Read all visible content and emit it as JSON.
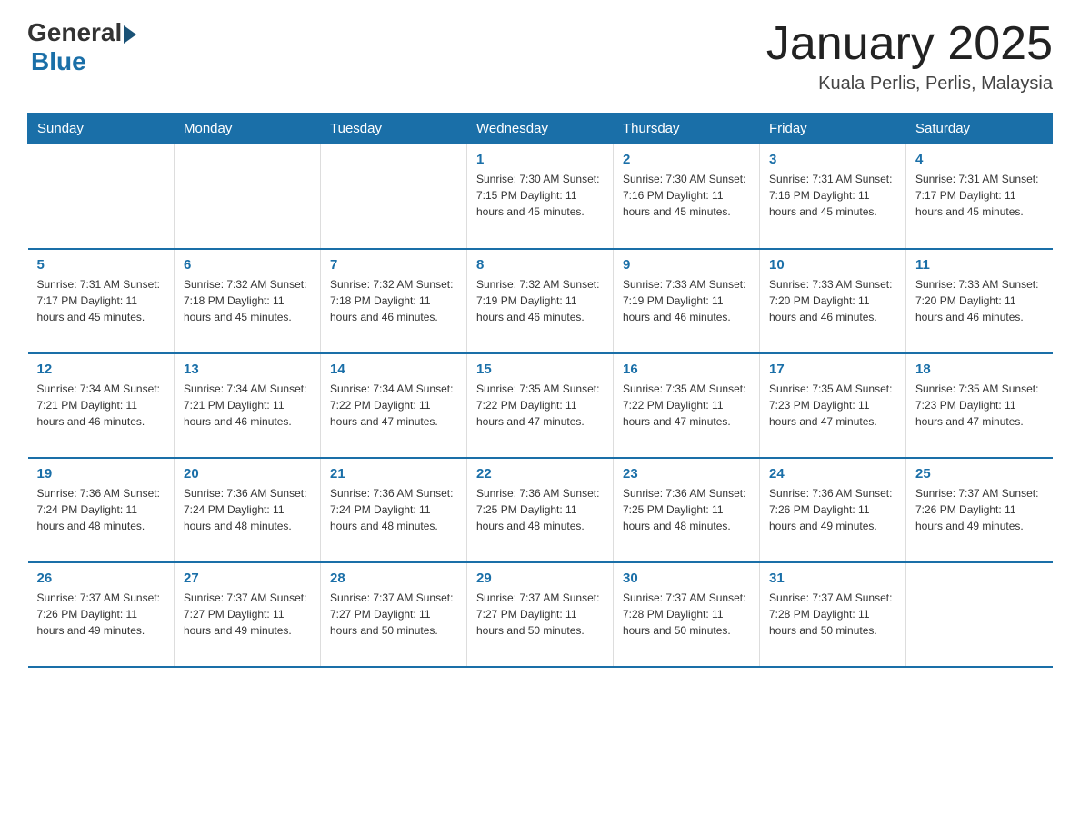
{
  "header": {
    "logo": {
      "general": "General",
      "blue": "Blue"
    },
    "title": "January 2025",
    "location": "Kuala Perlis, Perlis, Malaysia"
  },
  "days_of_week": [
    "Sunday",
    "Monday",
    "Tuesday",
    "Wednesday",
    "Thursday",
    "Friday",
    "Saturday"
  ],
  "weeks": [
    [
      {
        "day": "",
        "info": ""
      },
      {
        "day": "",
        "info": ""
      },
      {
        "day": "",
        "info": ""
      },
      {
        "day": "1",
        "info": "Sunrise: 7:30 AM\nSunset: 7:15 PM\nDaylight: 11 hours\nand 45 minutes."
      },
      {
        "day": "2",
        "info": "Sunrise: 7:30 AM\nSunset: 7:16 PM\nDaylight: 11 hours\nand 45 minutes."
      },
      {
        "day": "3",
        "info": "Sunrise: 7:31 AM\nSunset: 7:16 PM\nDaylight: 11 hours\nand 45 minutes."
      },
      {
        "day": "4",
        "info": "Sunrise: 7:31 AM\nSunset: 7:17 PM\nDaylight: 11 hours\nand 45 minutes."
      }
    ],
    [
      {
        "day": "5",
        "info": "Sunrise: 7:31 AM\nSunset: 7:17 PM\nDaylight: 11 hours\nand 45 minutes."
      },
      {
        "day": "6",
        "info": "Sunrise: 7:32 AM\nSunset: 7:18 PM\nDaylight: 11 hours\nand 45 minutes."
      },
      {
        "day": "7",
        "info": "Sunrise: 7:32 AM\nSunset: 7:18 PM\nDaylight: 11 hours\nand 46 minutes."
      },
      {
        "day": "8",
        "info": "Sunrise: 7:32 AM\nSunset: 7:19 PM\nDaylight: 11 hours\nand 46 minutes."
      },
      {
        "day": "9",
        "info": "Sunrise: 7:33 AM\nSunset: 7:19 PM\nDaylight: 11 hours\nand 46 minutes."
      },
      {
        "day": "10",
        "info": "Sunrise: 7:33 AM\nSunset: 7:20 PM\nDaylight: 11 hours\nand 46 minutes."
      },
      {
        "day": "11",
        "info": "Sunrise: 7:33 AM\nSunset: 7:20 PM\nDaylight: 11 hours\nand 46 minutes."
      }
    ],
    [
      {
        "day": "12",
        "info": "Sunrise: 7:34 AM\nSunset: 7:21 PM\nDaylight: 11 hours\nand 46 minutes."
      },
      {
        "day": "13",
        "info": "Sunrise: 7:34 AM\nSunset: 7:21 PM\nDaylight: 11 hours\nand 46 minutes."
      },
      {
        "day": "14",
        "info": "Sunrise: 7:34 AM\nSunset: 7:22 PM\nDaylight: 11 hours\nand 47 minutes."
      },
      {
        "day": "15",
        "info": "Sunrise: 7:35 AM\nSunset: 7:22 PM\nDaylight: 11 hours\nand 47 minutes."
      },
      {
        "day": "16",
        "info": "Sunrise: 7:35 AM\nSunset: 7:22 PM\nDaylight: 11 hours\nand 47 minutes."
      },
      {
        "day": "17",
        "info": "Sunrise: 7:35 AM\nSunset: 7:23 PM\nDaylight: 11 hours\nand 47 minutes."
      },
      {
        "day": "18",
        "info": "Sunrise: 7:35 AM\nSunset: 7:23 PM\nDaylight: 11 hours\nand 47 minutes."
      }
    ],
    [
      {
        "day": "19",
        "info": "Sunrise: 7:36 AM\nSunset: 7:24 PM\nDaylight: 11 hours\nand 48 minutes."
      },
      {
        "day": "20",
        "info": "Sunrise: 7:36 AM\nSunset: 7:24 PM\nDaylight: 11 hours\nand 48 minutes."
      },
      {
        "day": "21",
        "info": "Sunrise: 7:36 AM\nSunset: 7:24 PM\nDaylight: 11 hours\nand 48 minutes."
      },
      {
        "day": "22",
        "info": "Sunrise: 7:36 AM\nSunset: 7:25 PM\nDaylight: 11 hours\nand 48 minutes."
      },
      {
        "day": "23",
        "info": "Sunrise: 7:36 AM\nSunset: 7:25 PM\nDaylight: 11 hours\nand 48 minutes."
      },
      {
        "day": "24",
        "info": "Sunrise: 7:36 AM\nSunset: 7:26 PM\nDaylight: 11 hours\nand 49 minutes."
      },
      {
        "day": "25",
        "info": "Sunrise: 7:37 AM\nSunset: 7:26 PM\nDaylight: 11 hours\nand 49 minutes."
      }
    ],
    [
      {
        "day": "26",
        "info": "Sunrise: 7:37 AM\nSunset: 7:26 PM\nDaylight: 11 hours\nand 49 minutes."
      },
      {
        "day": "27",
        "info": "Sunrise: 7:37 AM\nSunset: 7:27 PM\nDaylight: 11 hours\nand 49 minutes."
      },
      {
        "day": "28",
        "info": "Sunrise: 7:37 AM\nSunset: 7:27 PM\nDaylight: 11 hours\nand 50 minutes."
      },
      {
        "day": "29",
        "info": "Sunrise: 7:37 AM\nSunset: 7:27 PM\nDaylight: 11 hours\nand 50 minutes."
      },
      {
        "day": "30",
        "info": "Sunrise: 7:37 AM\nSunset: 7:28 PM\nDaylight: 11 hours\nand 50 minutes."
      },
      {
        "day": "31",
        "info": "Sunrise: 7:37 AM\nSunset: 7:28 PM\nDaylight: 11 hours\nand 50 minutes."
      },
      {
        "day": "",
        "info": ""
      }
    ]
  ]
}
